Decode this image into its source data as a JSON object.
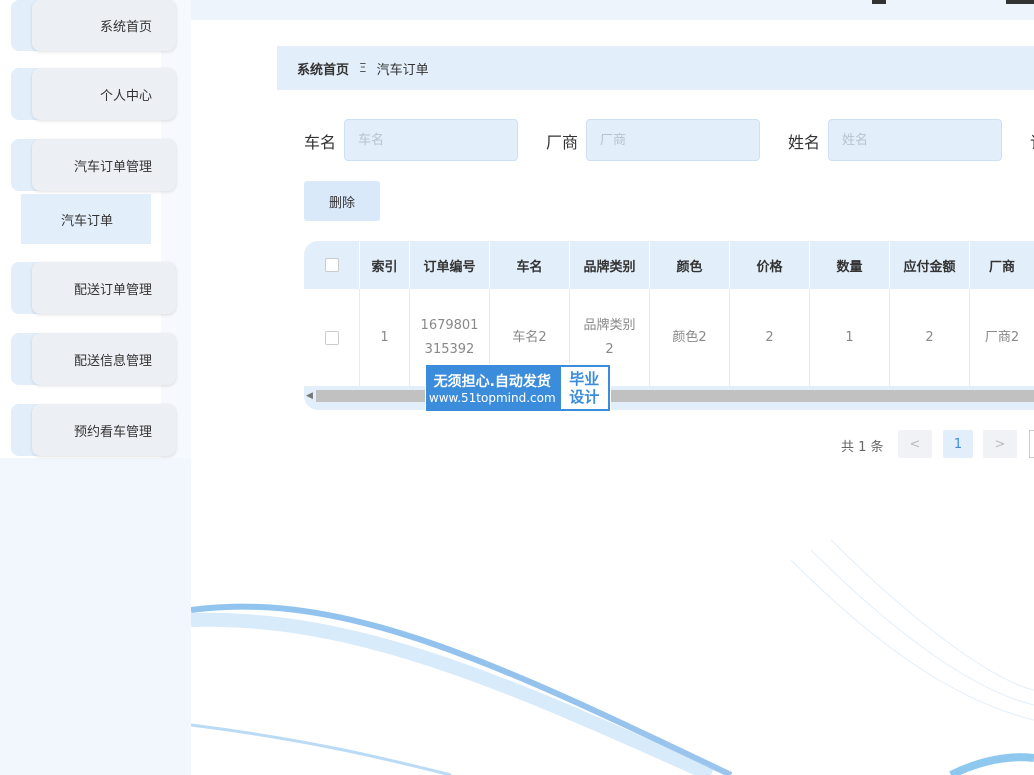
{
  "sidebar": {
    "items": [
      {
        "label": "系统首页"
      },
      {
        "label": "个人中心"
      },
      {
        "label": "汽车订单管理"
      },
      {
        "label": "配送订单管理"
      },
      {
        "label": "配送信息管理"
      },
      {
        "label": "预约看车管理"
      }
    ],
    "submenu_label": "汽车订单"
  },
  "breadcrumb": {
    "home": "系统首页",
    "separator": "Ξ",
    "current": "汽车订单"
  },
  "search": {
    "car_label": "车名",
    "car_placeholder": "车名",
    "maker_label": "厂商",
    "maker_placeholder": "厂商",
    "name_label": "姓名",
    "name_placeholder": "姓名",
    "next_label_partial": "订"
  },
  "toolbar": {
    "delete_label": "删除"
  },
  "table": {
    "headers": [
      "索引",
      "订单编号",
      "车名",
      "品牌类别",
      "颜色",
      "价格",
      "数量",
      "应付金额",
      "厂商"
    ],
    "rows": [
      {
        "index": "1",
        "order_no_l1": "1679801",
        "order_no_l2": "315392",
        "car": "车名2",
        "brand_l1": "品牌类别",
        "brand_l2": "2",
        "color": "颜色2",
        "price": "2",
        "qty": "1",
        "amount": "2",
        "maker": "厂商2"
      }
    ]
  },
  "watermark": {
    "line1": "无须担心.自动发货",
    "line2": "www.51topmind.com",
    "badge_l1": "毕业",
    "badge_l2": "设计"
  },
  "pagination": {
    "total": "共 1 条",
    "prev": "<",
    "current": "1",
    "next": ">"
  },
  "colors": {
    "accent": "#3b8ddc",
    "light_blue": "#e2eefa",
    "sidebar_bg": "#f2f7fd"
  }
}
